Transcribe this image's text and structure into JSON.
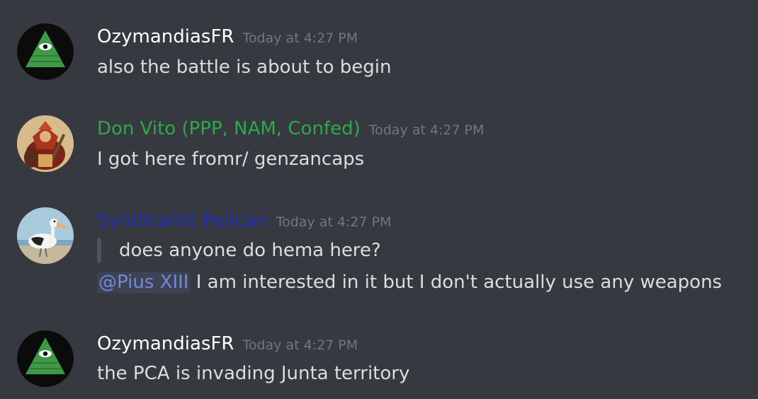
{
  "messages": [
    {
      "username": "OzymandiasFR",
      "username_color": "#ffffff",
      "timestamp": "Today at 4:27 PM",
      "avatar_icon": "illuminati-eye-pyramid-icon",
      "lines": [
        "also the battle is about to begin"
      ]
    },
    {
      "username": "Don Vito (PPP, NAM, Confed)",
      "username_color": "#2fa84a",
      "timestamp": "Today at 4:27 PM",
      "avatar_icon": "warrior-painting-icon",
      "lines": [
        "I got here fromr/ genzancaps"
      ]
    },
    {
      "username": "Syndicalist Pelican",
      "username_color": "#1f2bb5",
      "timestamp": "Today at 4:27 PM",
      "avatar_icon": "pelican-photo-icon",
      "quote": "does anyone do hema here?",
      "mention": "@Pius XIII",
      "reply_text": " I am interested in it but I don't actually use any weapons"
    },
    {
      "username": "OzymandiasFR",
      "username_color": "#ffffff",
      "timestamp": "Today at 4:27 PM",
      "avatar_icon": "illuminati-eye-pyramid-icon",
      "lines": [
        "the PCA is invading Junta territory"
      ]
    }
  ]
}
